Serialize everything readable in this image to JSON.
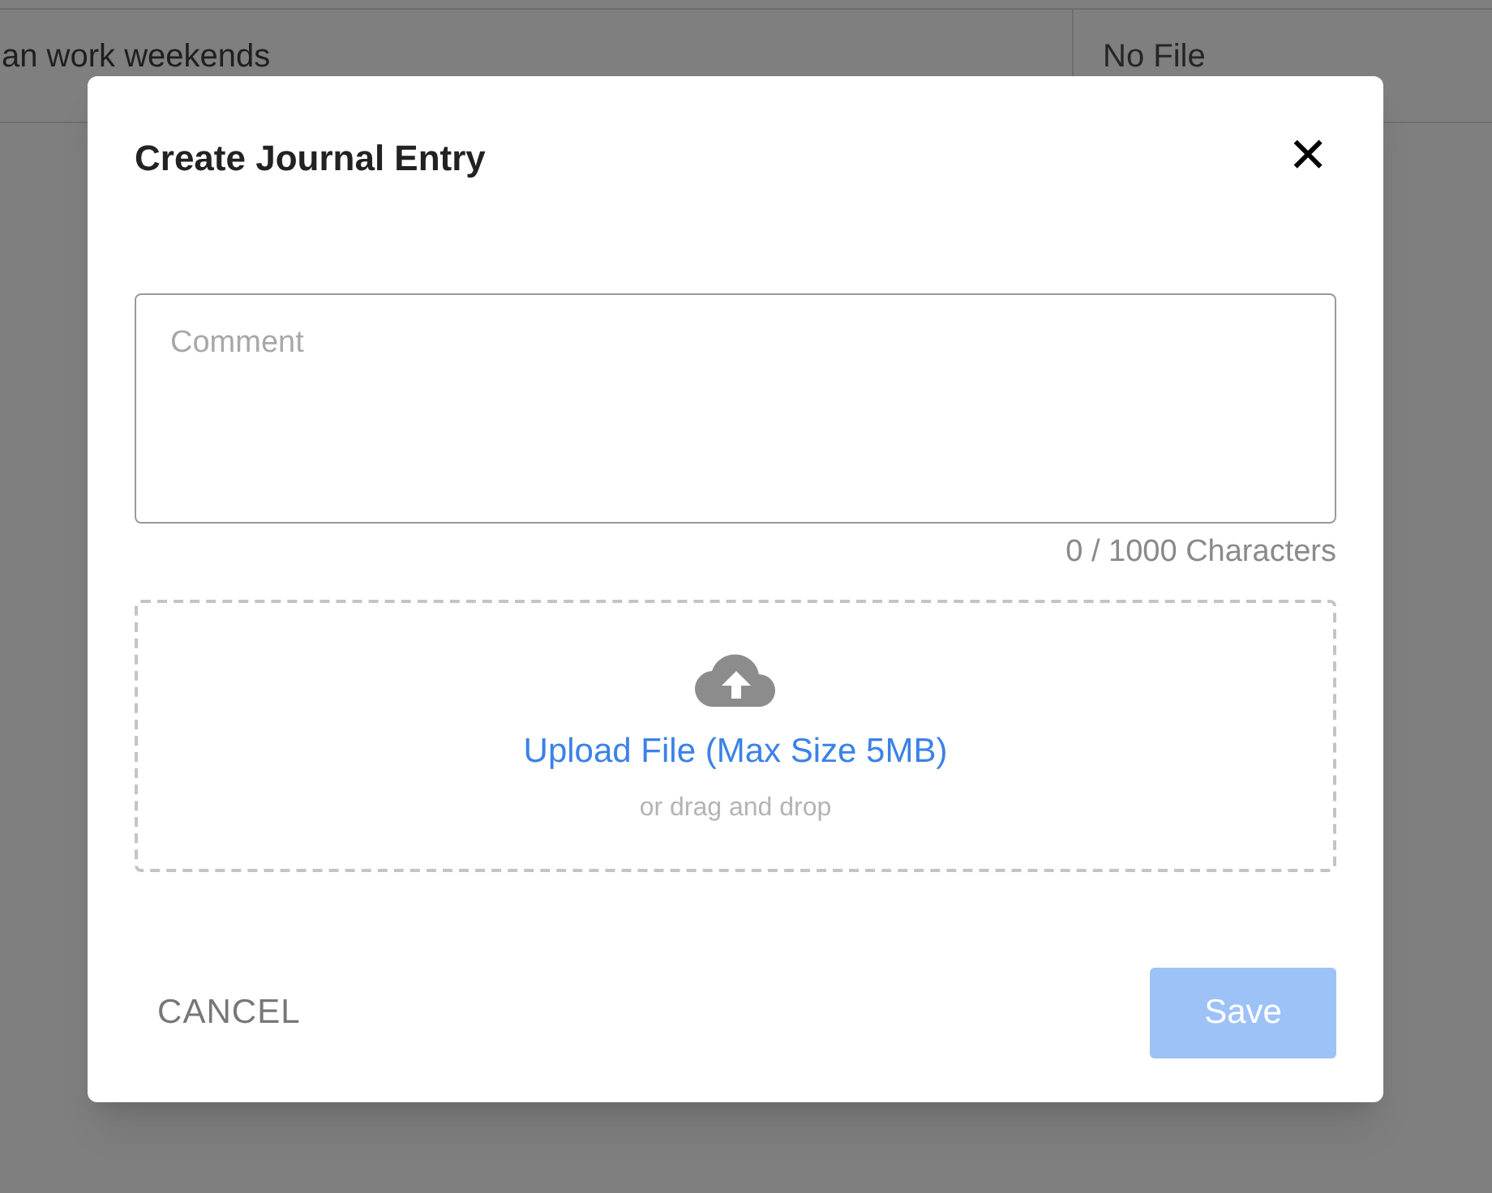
{
  "background_table": {
    "row": {
      "cells": [
        "an work weekends",
        "No File"
      ]
    }
  },
  "dialog": {
    "title": "Create Journal Entry",
    "close_label": "✕",
    "comment": {
      "placeholder": "Comment"
    },
    "counter": "0 / 1000 Characters",
    "upload": {
      "link": "Upload File (Max Size 5MB)",
      "hint": "or drag and drop"
    },
    "buttons": [
      {
        "label": "CANCEL",
        "kind": "text",
        "disabled": false
      },
      {
        "label": "Save",
        "kind": "primary",
        "disabled": true
      }
    ]
  }
}
